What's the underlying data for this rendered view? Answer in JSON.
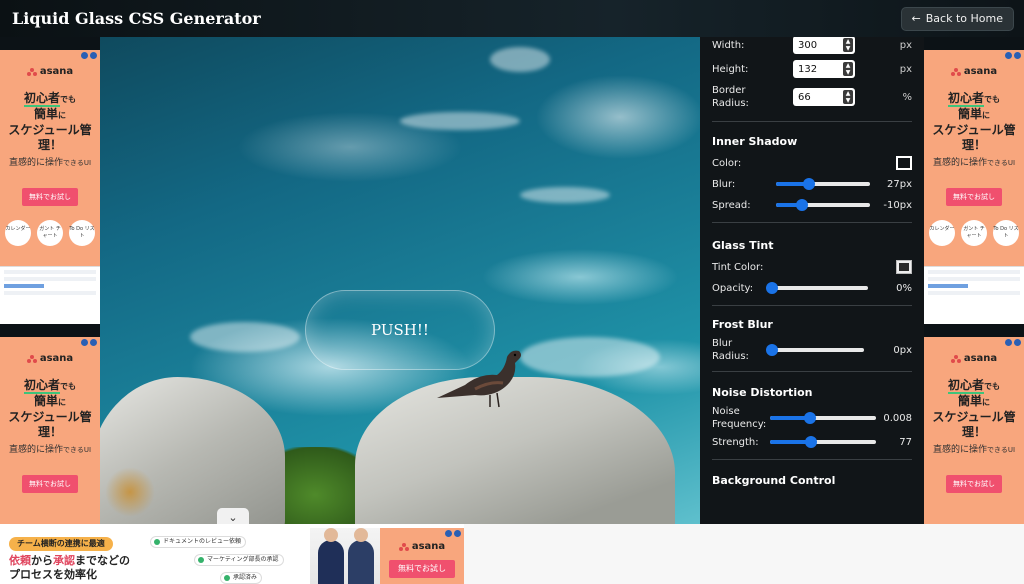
{
  "header": {
    "title": "Liquid Glass CSS Generator",
    "back_label": "Back to Home"
  },
  "preview": {
    "button_text": "PUSH!!"
  },
  "panel": {
    "width": {
      "label": "Width:",
      "value": "300",
      "unit": "px"
    },
    "height": {
      "label": "Height:",
      "value": "132",
      "unit": "px"
    },
    "radius": {
      "label_1": "Border",
      "label_2": "Radius:",
      "value": "66",
      "unit": "%"
    },
    "inner_shadow": {
      "title": "Inner Shadow",
      "color_label": "Color:",
      "blur_label": "Blur:",
      "blur_value": "27px",
      "blur_fraction": 0.35,
      "spread_label": "Spread:",
      "spread_value": "-10px",
      "spread_fraction": 0.28
    },
    "glass_tint": {
      "title": "Glass Tint",
      "tint_label": "Tint Color:",
      "opacity_label": "Opacity:",
      "opacity_value": "0%",
      "opacity_fraction": 0.02
    },
    "frost_blur": {
      "title": "Frost Blur",
      "radius_label_1": "Blur",
      "radius_label_2": "Radius:",
      "radius_value": "0px",
      "radius_fraction": 0.02
    },
    "noise": {
      "title": "Noise Distortion",
      "freq_label_1": "Noise",
      "freq_label_2": "Frequency:",
      "freq_value": "0.008",
      "freq_fraction": 0.38,
      "strength_label": "Strength:",
      "strength_value": "77",
      "strength_fraction": 0.39
    },
    "background": {
      "title": "Background Control"
    }
  },
  "ads": {
    "brand": "asana",
    "headline_1": "初心者",
    "headline_1b": "でも",
    "headline_2": "簡単",
    "headline_2b": "に",
    "headline_3": "スケジュール管理！",
    "sub_1": "直感的に操作",
    "sub_2": "できるUI",
    "cta": "無料でお試し",
    "icon_1": "カレンダー",
    "icon_2": "ガント チャート",
    "icon_3": "To Do リスト"
  },
  "banner": {
    "tag": "チーム横断の連携に最適",
    "line1_a": "依頼",
    "line1_b": "から",
    "line1_c": "承認",
    "line1_d": "までなどの",
    "line2": "プロセスを効率化",
    "flow_1": "ドキュメントのレビュー依頼",
    "flow_2": "マーケティング部長の承認",
    "flow_3": "承認済み",
    "brand": "asana",
    "cta": "無料でお試し"
  },
  "colors": {
    "accent": "#1a73e8",
    "ad_bg": "#f8a67d",
    "cta": "#f0506e"
  }
}
